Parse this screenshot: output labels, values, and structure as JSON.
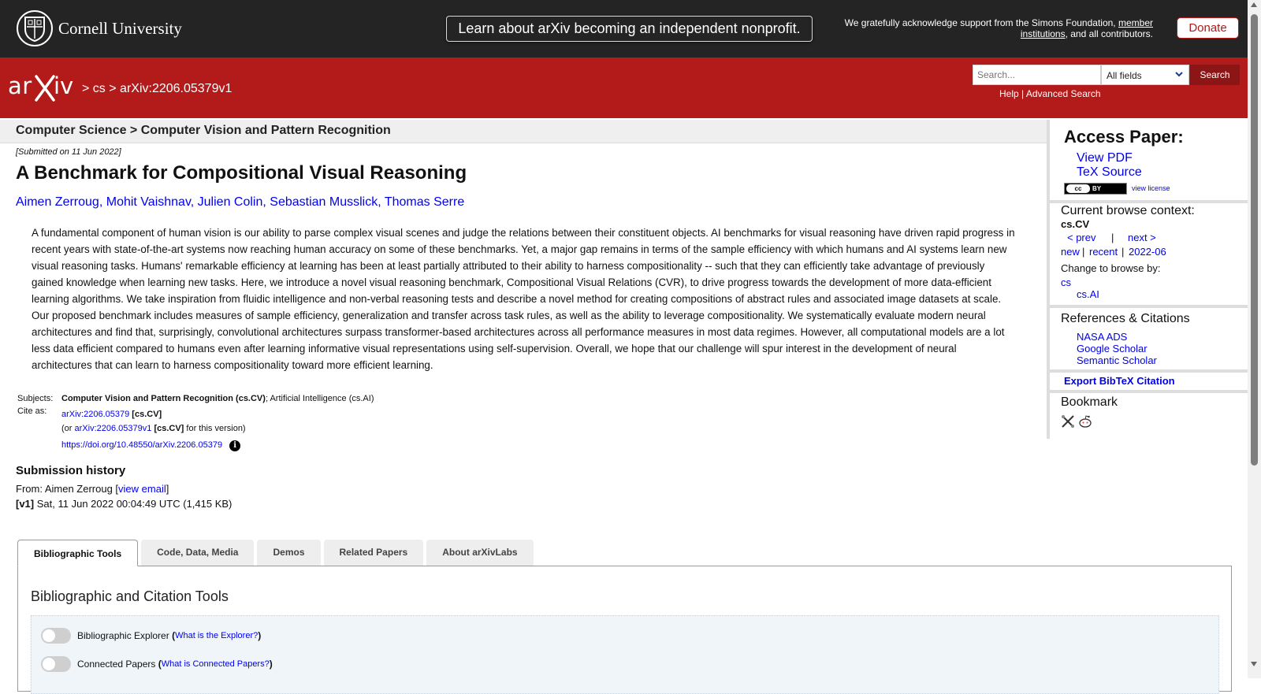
{
  "topbar": {
    "university": "Cornell University",
    "notice": "Learn about arXiv becoming an independent nonprofit.",
    "support_pre": "We gratefully acknowledge support from the Simons Foundation,",
    "support_link1a": "member",
    "support_link1b": "institutions",
    "support_post": ", and all contributors.",
    "donate": "Donate"
  },
  "header": {
    "crumb_sep": ">",
    "crumb_cs": "cs",
    "crumb_id": "arXiv:2206.05379v1",
    "search_placeholder": "Search...",
    "field_value": "All fields",
    "search_button": "Search",
    "help": "Help",
    "pipe": "|",
    "advanced": "Advanced Search"
  },
  "paper": {
    "category_bar": "Computer Science > Computer Vision and Pattern Recognition",
    "submitted": "[Submitted on 11 Jun 2022]",
    "title": "A Benchmark for Compositional Visual Reasoning",
    "authors": [
      "Aimen Zerroug",
      "Mohit Vaishnav",
      "Julien Colin",
      "Sebastian Musslick",
      "Thomas Serre"
    ],
    "author_sep": ",",
    "abstract": "A fundamental component of human vision is our ability to parse complex visual scenes and judge the relations between their constituent objects. AI benchmarks for visual reasoning have driven rapid progress in recent years with state-of-the-art systems now reaching human accuracy on some of these benchmarks. Yet, a major gap remains in terms of the sample efficiency with which humans and AI systems learn new visual reasoning tasks. Humans' remarkable efficiency at learning has been at least partially attributed to their ability to harness compositionality -- such that they can efficiently take advantage of previously gained knowledge when learning new tasks. Here, we introduce a novel visual reasoning benchmark, Compositional Visual Relations (CVR), to drive progress towards the development of more data-efficient learning algorithms. We take inspiration from fluidic intelligence and non-verbal reasoning tests and describe a novel method for creating compositions of abstract rules and associated image datasets at scale. Our proposed benchmark includes measures of sample efficiency, generalization and transfer across task rules, as well as the ability to leverage compositionality. We systematically evaluate modern neural architectures and find that, surprisingly, convolutional architectures surpass transformer-based architectures across all performance measures in most data regimes. However, all computational models are a lot less data efficient compared to humans even after learning informative visual representations using self-supervision. Overall, we hope that our challenge will spur interest in the development of neural architectures that can learn to harness compositionality toward more efficient learning.",
    "subjects_label": "Subjects:",
    "subjects_primary": "Computer Vision and Pattern Recognition (cs.CV)",
    "subjects_rest": "; Artificial Intelligence (cs.AI)",
    "cite_label": "Cite as:",
    "cite_id": "arXiv:2206.05379",
    "cite_cat": "[cs.CV]",
    "cite_or": "(or",
    "cite_v_id": "arXiv:2206.05379v1",
    "cite_v_cat": "[cs.CV]",
    "cite_v_post": "for this version)",
    "doi": "https://doi.org/10.48550/arXiv.2206.05379",
    "info_glyph": "i",
    "history_heading": "Submission history",
    "from_pre": "From: Aimen Zerroug [",
    "from_link": "view email",
    "from_post": "]",
    "v1_tag": "[v1]",
    "v1_text": "Sat, 11 Jun 2022 00:04:49 UTC (1,415 KB)"
  },
  "tabs": {
    "items": [
      "Bibliographic Tools",
      "Code, Data, Media",
      "Demos",
      "Related Papers",
      "About arXivLabs"
    ],
    "panel_title": "Bibliographic and Citation Tools",
    "toggle1_label": "Bibliographic Explorer",
    "toggle1_q": "What is the Explorer?",
    "toggle2_label": "Connected Papers",
    "toggle2_q": "What is Connected Papers?",
    "paren_open": "(",
    "paren_close": ")"
  },
  "sidebar": {
    "access_heading": "Access Paper:",
    "view_pdf": "View PDF",
    "tex_source": "TeX Source",
    "cc": "cc",
    "by": "BY",
    "view_license": "view license",
    "browse_heading": "Current browse context:",
    "browse_ctx": "cs.CV",
    "prev": "< prev",
    "nav_pipe": "|",
    "next": "next >",
    "new": "new",
    "recent": "recent",
    "month": "2022-06",
    "change_browse": "Change to browse by:",
    "cs": "cs",
    "cs_ai": "cs.AI",
    "refs_heading": "References & Citations",
    "nasa": "NASA ADS",
    "scholar": "Google Scholar",
    "semantic": "Semantic Scholar",
    "export": "Export BibTeX Citation",
    "bookmark": "Bookmark"
  },
  "icons": [
    "cornell-seal-icon",
    "chevron-down-icon",
    "info-icon",
    "bibsonomy-icon",
    "reddit-icon"
  ]
}
